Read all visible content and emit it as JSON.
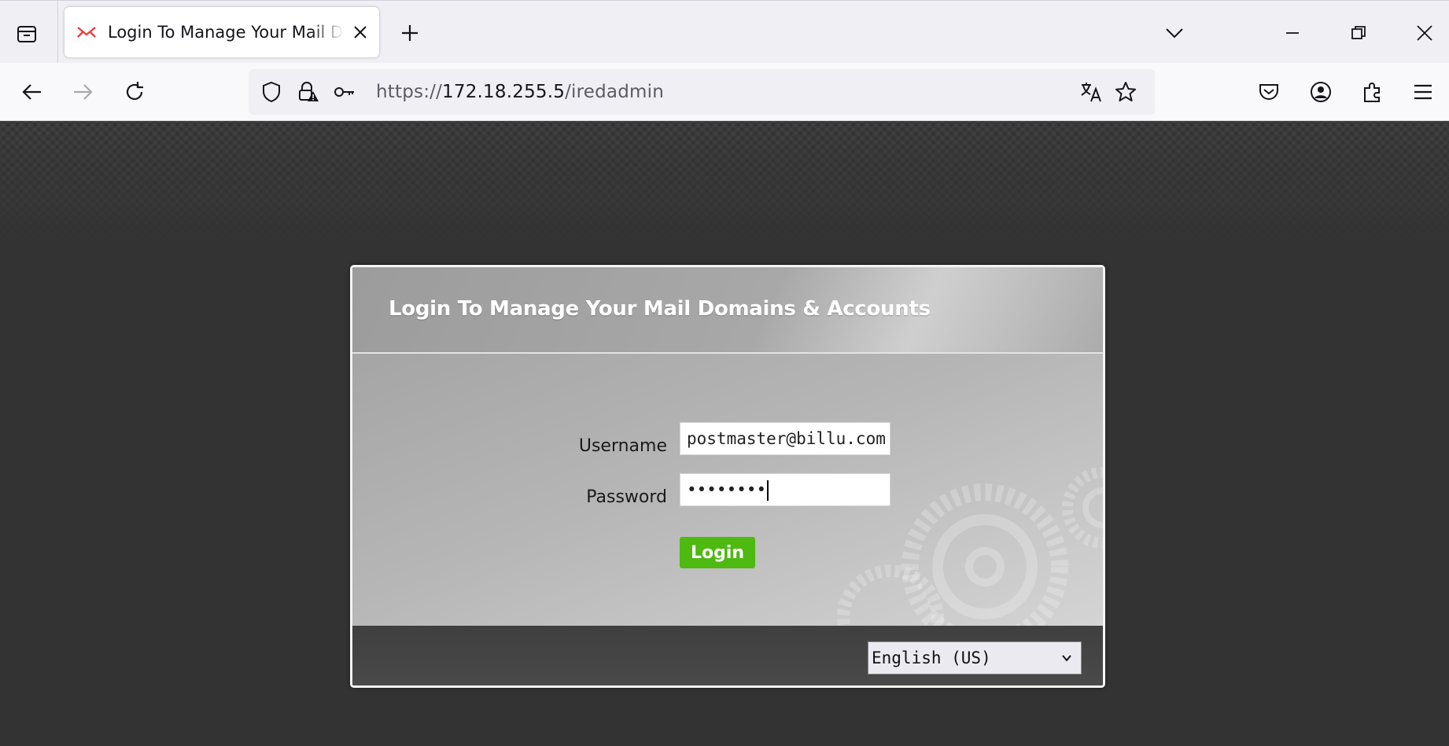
{
  "browser": {
    "tab": {
      "title": "Login To Manage Your Mail Domains & Accounts"
    },
    "url": {
      "scheme": "https://",
      "host": "172.18.255.5",
      "path": "/iredadmin"
    }
  },
  "login": {
    "heading": "Login To Manage Your Mail Domains & Accounts",
    "username_label": "Username",
    "username_value": "postmaster@billu.com",
    "password_label": "Password",
    "password_masked": "••••••••",
    "login_button": "Login",
    "language": "English (US)"
  },
  "colors": {
    "accent_button": "#4db911",
    "page_background": "#333333"
  }
}
